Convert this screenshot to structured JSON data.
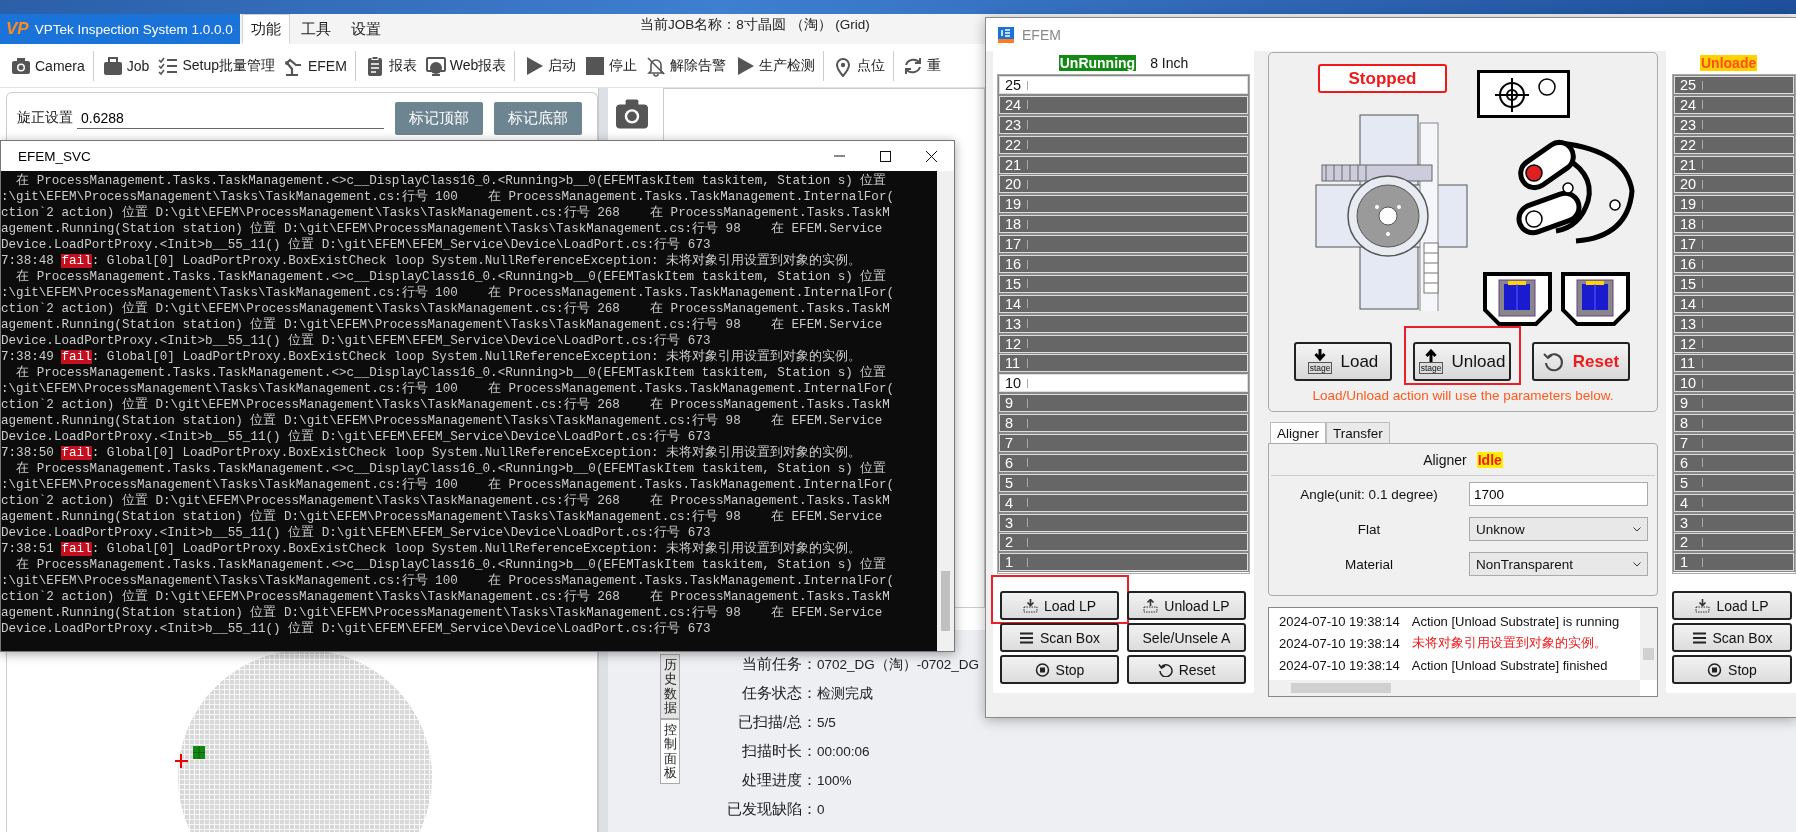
{
  "main_window": {
    "logo": "VP",
    "title": "VPTek Inspection System 1.0.0.0",
    "menus": [
      {
        "label": "功能",
        "selected": true
      },
      {
        "label": "工具",
        "selected": false
      },
      {
        "label": "设置",
        "selected": false
      }
    ],
    "job_name": "当前JOB名称：8寸晶圆 （淘） (Grid)",
    "toolbar": [
      {
        "kind": "camera",
        "label": "Camera",
        "separator_after": true
      },
      {
        "kind": "briefcase",
        "label": "Job",
        "separator_after": false
      },
      {
        "kind": "checklist",
        "label": "Setup批量管理",
        "separator_after": false
      },
      {
        "kind": "robot",
        "label": "EFEM",
        "separator_after": true
      },
      {
        "kind": "clipboard",
        "label": "报表",
        "separator_after": false
      },
      {
        "kind": "globe",
        "label": "Web报表",
        "separator_after": true
      },
      {
        "kind": "play",
        "label": "启动",
        "separator_after": false
      },
      {
        "kind": "stop",
        "label": "停止",
        "separator_after": false
      },
      {
        "kind": "bell-off",
        "label": "解除告警",
        "separator_after": false
      },
      {
        "kind": "play",
        "label": "生产检测",
        "separator_after": true
      },
      {
        "kind": "pin",
        "label": "点位",
        "separator_after": true
      },
      {
        "kind": "refresh",
        "label": "重",
        "separator_after": false
      }
    ],
    "rotation": {
      "label": "旋正设置",
      "value": "0.6288"
    },
    "mark_buttons": [
      "标记顶部",
      "标记底部"
    ],
    "side_tabs": [
      {
        "label": "历史数据",
        "selected": false
      },
      {
        "label": "控制面板",
        "selected": true
      }
    ],
    "task_info": [
      {
        "label": "当前任务：",
        "value": "0702_DG（淘）-0702_DG"
      },
      {
        "label": "任务状态：",
        "value": "检测完成"
      },
      {
        "label": "已扫描/总：",
        "value": "5/5"
      },
      {
        "label": "扫描时长：",
        "value": "00:00:06"
      },
      {
        "label": "处理进度：",
        "value": "100%"
      },
      {
        "label": "已发现缺陷：",
        "value": "0"
      }
    ]
  },
  "console": {
    "title": "EFEM_SVC",
    "lines": [
      {
        "kind": "trace",
        "text": "  在 ProcessManagement.Tasks.TaskManagement.<>c__DisplayClass16_0.<Running>b__0(EFEMTaskItem taskitem, Station s) 位置"
      },
      {
        "kind": "trace",
        "text": ":\\git\\EFEM\\ProcessManagement\\Tasks\\TaskManagement.cs:行号 100    在 ProcessManagement.Tasks.TaskManagement.InternalFor("
      },
      {
        "kind": "trace",
        "text": "ction`2 action) 位置 D:\\git\\EFEM\\ProcessManagement\\Tasks\\TaskManagement.cs:行号 268    在 ProcessManagement.Tasks.TaskM"
      },
      {
        "kind": "trace",
        "text": "agement.Running(Station station) 位置 D:\\git\\EFEM\\ProcessManagement\\Tasks\\TaskManagement.cs:行号 98    在 EFEM.Service"
      },
      {
        "kind": "trace",
        "text": "Device.LoadPortProxy.<Init>b__55_11() 位置 D:\\git\\EFEM\\EFEM_Service\\Device\\LoadPort.cs:行号 673"
      },
      {
        "kind": "fail",
        "time": "7:38:48",
        "level": "fail",
        "message": ": Global[0] LoadPortProxy.BoxExistCheck loop System.NullReferenceException: 未将对象引用设置到对象的实例。"
      },
      {
        "kind": "trace",
        "text": "  在 ProcessManagement.Tasks.TaskManagement.<>c__DisplayClass16_0.<Running>b__0(EFEMTaskItem taskitem, Station s) 位置"
      },
      {
        "kind": "trace",
        "text": ":\\git\\EFEM\\ProcessManagement\\Tasks\\TaskManagement.cs:行号 100    在 ProcessManagement.Tasks.TaskManagement.InternalFor("
      },
      {
        "kind": "trace",
        "text": "ction`2 action) 位置 D:\\git\\EFEM\\ProcessManagement\\Tasks\\TaskManagement.cs:行号 268    在 ProcessManagement.Tasks.TaskM"
      },
      {
        "kind": "trace",
        "text": "agement.Running(Station station) 位置 D:\\git\\EFEM\\ProcessManagement\\Tasks\\TaskManagement.cs:行号 98    在 EFEM.Service"
      },
      {
        "kind": "trace",
        "text": "Device.LoadPortProxy.<Init>b__55_11() 位置 D:\\git\\EFEM\\EFEM_Service\\Device\\LoadPort.cs:行号 673"
      },
      {
        "kind": "fail",
        "time": "7:38:49",
        "level": "fail",
        "message": ": Global[0] LoadPortProxy.BoxExistCheck loop System.NullReferenceException: 未将对象引用设置到对象的实例。"
      },
      {
        "kind": "trace",
        "text": "  在 ProcessManagement.Tasks.TaskManagement.<>c__DisplayClass16_0.<Running>b__0(EFEMTaskItem taskitem, Station s) 位置"
      },
      {
        "kind": "trace",
        "text": ":\\git\\EFEM\\ProcessManagement\\Tasks\\TaskManagement.cs:行号 100    在 ProcessManagement.Tasks.TaskManagement.InternalFor("
      },
      {
        "kind": "trace",
        "text": "ction`2 action) 位置 D:\\git\\EFEM\\ProcessManagement\\Tasks\\TaskManagement.cs:行号 268    在 ProcessManagement.Tasks.TaskM"
      },
      {
        "kind": "trace",
        "text": "agement.Running(Station station) 位置 D:\\git\\EFEM\\ProcessManagement\\Tasks\\TaskManagement.cs:行号 98    在 EFEM.Service"
      },
      {
        "kind": "trace",
        "text": "Device.LoadPortProxy.<Init>b__55_11() 位置 D:\\git\\EFEM\\EFEM_Service\\Device\\LoadPort.cs:行号 673"
      },
      {
        "kind": "fail",
        "time": "7:38:50",
        "level": "fail",
        "message": ": Global[0] LoadPortProxy.BoxExistCheck loop System.NullReferenceException: 未将对象引用设置到对象的实例。"
      },
      {
        "kind": "trace",
        "text": "  在 ProcessManagement.Tasks.TaskManagement.<>c__DisplayClass16_0.<Running>b__0(EFEMTaskItem taskitem, Station s) 位置"
      },
      {
        "kind": "trace",
        "text": ":\\git\\EFEM\\ProcessManagement\\Tasks\\TaskManagement.cs:行号 100    在 ProcessManagement.Tasks.TaskManagement.InternalFor("
      },
      {
        "kind": "trace",
        "text": "ction`2 action) 位置 D:\\git\\EFEM\\ProcessManagement\\Tasks\\TaskManagement.cs:行号 268    在 ProcessManagement.Tasks.TaskM"
      },
      {
        "kind": "trace",
        "text": "agement.Running(Station station) 位置 D:\\git\\EFEM\\ProcessManagement\\Tasks\\TaskManagement.cs:行号 98    在 EFEM.Service"
      },
      {
        "kind": "trace",
        "text": "Device.LoadPortProxy.<Init>b__55_11() 位置 D:\\git\\EFEM\\EFEM_Service\\Device\\LoadPort.cs:行号 673"
      },
      {
        "kind": "fail",
        "time": "7:38:51",
        "level": "fail",
        "message": ": Global[0] LoadPortProxy.BoxExistCheck loop System.NullReferenceException: 未将对象引用设置到对象的实例。"
      },
      {
        "kind": "trace",
        "text": "  在 ProcessManagement.Tasks.TaskManagement.<>c__DisplayClass16_0.<Running>b__0(EFEMTaskItem taskitem, Station s) 位置"
      },
      {
        "kind": "trace",
        "text": ":\\git\\EFEM\\ProcessManagement\\Tasks\\TaskManagement.cs:行号 100    在 ProcessManagement.Tasks.TaskManagement.InternalFor("
      },
      {
        "kind": "trace",
        "text": "ction`2 action) 位置 D:\\git\\EFEM\\ProcessManagement\\Tasks\\TaskManagement.cs:行号 268    在 ProcessManagement.Tasks.TaskM"
      },
      {
        "kind": "trace",
        "text": "agement.Running(Station station) 位置 D:\\git\\EFEM\\ProcessManagement\\Tasks\\TaskManagement.cs:行号 98    在 EFEM.Service"
      },
      {
        "kind": "trace",
        "text": "Device.LoadPortProxy.<Init>b__55_11() 位置 D:\\git\\EFEM\\EFEM_Service\\Device\\LoadPort.cs:行号 673"
      }
    ]
  },
  "efem": {
    "title": "EFEM",
    "left_port": {
      "status": "UnRunning",
      "size": "8 Inch",
      "slots": [
        {
          "label": "25",
          "selected": true
        },
        {
          "label": "24",
          "selected": false
        },
        {
          "label": "23",
          "selected": false
        },
        {
          "label": "22",
          "selected": false
        },
        {
          "label": "21",
          "selected": false
        },
        {
          "label": "20",
          "selected": false
        },
        {
          "label": "19",
          "selected": false
        },
        {
          "label": "18",
          "selected": false
        },
        {
          "label": "17",
          "selected": false
        },
        {
          "label": "16",
          "selected": false
        },
        {
          "label": "15",
          "selected": false
        },
        {
          "label": "14",
          "selected": false
        },
        {
          "label": "13",
          "selected": false
        },
        {
          "label": "12",
          "selected": false
        },
        {
          "label": "11",
          "selected": false
        },
        {
          "label": "10",
          "selected": true
        },
        {
          "label": "9",
          "selected": false
        },
        {
          "label": "8",
          "selected": false
        },
        {
          "label": "7",
          "selected": false
        },
        {
          "label": "6",
          "selected": false
        },
        {
          "label": "5",
          "selected": false
        },
        {
          "label": "4",
          "selected": false
        },
        {
          "label": "3",
          "selected": false
        },
        {
          "label": "2",
          "selected": false
        },
        {
          "label": "1",
          "selected": false
        }
      ],
      "buttons": [
        {
          "kind": "load",
          "label": "Load LP",
          "annotated": true
        },
        {
          "kind": "unload",
          "label": "Unload LP",
          "annotated": false
        },
        {
          "kind": "list",
          "label": "Scan Box",
          "annotated": false
        },
        {
          "kind": "plain",
          "label": "Sele/Unsele A",
          "annotated": false
        },
        {
          "kind": "stop",
          "label": "Stop",
          "annotated": false
        },
        {
          "kind": "reset",
          "label": "Reset",
          "annotated": false
        }
      ]
    },
    "robot_status": "Stopped",
    "actions": [
      {
        "kind": "load",
        "label": "Load",
        "icon_text": "stage",
        "annotated": false
      },
      {
        "kind": "unload",
        "label": "Unload",
        "icon_text": "stage",
        "annotated": true
      },
      {
        "kind": "reset",
        "label": "Reset",
        "annotated": false
      }
    ],
    "note": "Load/Unload action will use the parameters below.",
    "tabs": [
      {
        "label": "Aligner",
        "selected": true
      },
      {
        "label": "Transfer",
        "selected": false
      }
    ],
    "aligner": {
      "label": "Aligner",
      "status": "Idle",
      "fields": [
        {
          "kind": "text",
          "label": "Angle(unit:  0.1 degree)",
          "value": "1700"
        },
        {
          "kind": "select",
          "label": "Flat",
          "value": "Unknow"
        },
        {
          "kind": "select",
          "label": "Material",
          "value": "NonTransparent"
        }
      ]
    },
    "log": [
      {
        "time": "2024-07-10 19:38:14",
        "message": "Action [Unload Substrate] is running",
        "kind": "info"
      },
      {
        "time": "2024-07-10 19:38:14",
        "message": "未将对象引用设置到对象的实例。",
        "kind": "error"
      },
      {
        "time": "2024-07-10 19:38:14",
        "message": "Action [Unload Substrate] finished",
        "kind": "info"
      }
    ],
    "right_port": {
      "status": "Unloade",
      "slots": [
        {
          "label": "25",
          "selected": false
        },
        {
          "label": "24",
          "selected": false
        },
        {
          "label": "23",
          "selected": false
        },
        {
          "label": "22",
          "selected": false
        },
        {
          "label": "21",
          "selected": false
        },
        {
          "label": "20",
          "selected": false
        },
        {
          "label": "19",
          "selected": false
        },
        {
          "label": "18",
          "selected": false
        },
        {
          "label": "17",
          "selected": false
        },
        {
          "label": "16",
          "selected": false
        },
        {
          "label": "15",
          "selected": false
        },
        {
          "label": "14",
          "selected": false
        },
        {
          "label": "13",
          "selected": false
        },
        {
          "label": "12",
          "selected": false
        },
        {
          "label": "11",
          "selected": false
        },
        {
          "label": "10",
          "selected": false
        },
        {
          "label": "9",
          "selected": false
        },
        {
          "label": "8",
          "selected": false
        },
        {
          "label": "7",
          "selected": false
        },
        {
          "label": "6",
          "selected": false
        },
        {
          "label": "5",
          "selected": false
        },
        {
          "label": "4",
          "selected": false
        },
        {
          "label": "3",
          "selected": false
        },
        {
          "label": "2",
          "selected": false
        },
        {
          "label": "1",
          "selected": false
        }
      ],
      "buttons": [
        {
          "kind": "load",
          "label": "Load LP",
          "annotated": false
        },
        {
          "kind": "list",
          "label": "Scan Box",
          "annotated": false
        },
        {
          "kind": "stop",
          "label": "Stop",
          "annotated": false
        }
      ]
    }
  }
}
